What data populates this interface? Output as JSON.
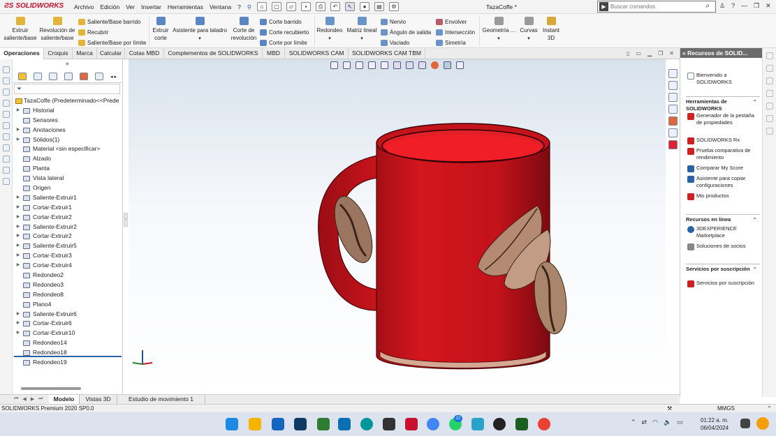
{
  "app": {
    "brand": "SOLIDWORKS",
    "doc_title": "TazaCoffe *",
    "menus": [
      "Archivo",
      "Edición",
      "Ver",
      "Insertar",
      "Herramientas",
      "Ventana",
      "?"
    ],
    "search_placeholder": "Buscar comandos"
  },
  "commands": {
    "extrude_boss": "Extruir saliente/base",
    "revolve_boss": "Revolución de saliente/base",
    "swept_boss": "Saliente/Base barrido",
    "loft_boss": "Recubrir",
    "boundary_boss": "Saliente/Base por límite",
    "extrude_cut": "Extruir corte",
    "hole_wizard": "Asistente para taladro",
    "revolve_cut": "Corte de revolución",
    "swept_cut": "Corte barrido",
    "loft_cut": "Corte recubierto",
    "boundary_cut": "Corte por límite",
    "fillet": "Redondeo",
    "linear_pattern": "Matriz lineal",
    "rib": "Nervio",
    "draft": "Ángulo de salida",
    "shell": "Vaciado",
    "wrap": "Envolver",
    "intersect": "Intersección",
    "mirror": "Simetría",
    "ref_geometry": "Geometría ...",
    "curves": "Curvas",
    "instant3d": "Instant 3D"
  },
  "tabs": [
    {
      "label": "Operaciones",
      "active": true
    },
    {
      "label": "Croquis",
      "active": false
    },
    {
      "label": "Marca",
      "active": false
    },
    {
      "label": "Calcular",
      "active": false
    },
    {
      "label": "Cotas MBD",
      "active": false
    },
    {
      "label": "Complementos de SOLIDWORKS",
      "active": false
    },
    {
      "label": "MBD",
      "active": false
    },
    {
      "label": "SOLIDWORKS CAM",
      "active": false
    },
    {
      "label": "SOLIDWORKS CAM TBM",
      "active": false
    }
  ],
  "tree": {
    "root": "TazaCoffe  (Predeterminado<<Prede",
    "items": [
      {
        "label": "Historial",
        "expandable": true
      },
      {
        "label": "Sensores",
        "expandable": false
      },
      {
        "label": "Anotaciones",
        "expandable": true
      },
      {
        "label": "Sólidos(1)",
        "expandable": true
      },
      {
        "label": "Material <sin especificar>",
        "expandable": false
      },
      {
        "label": "Alzado",
        "expandable": false
      },
      {
        "label": "Planta",
        "expandable": false
      },
      {
        "label": "Vista lateral",
        "expandable": false
      },
      {
        "label": "Origen",
        "expandable": false
      },
      {
        "label": "Saliente-Extruir1",
        "expandable": true
      },
      {
        "label": "Cortar-Extruir1",
        "expandable": true
      },
      {
        "label": "Cortar-Extruir2",
        "expandable": true
      },
      {
        "label": "Saliente-Extruir2",
        "expandable": true
      },
      {
        "label": "Cortar-Extruir2",
        "expandable": true
      },
      {
        "label": "Saliente-Extruir5",
        "expandable": true
      },
      {
        "label": "Cortar-Extruir3",
        "expandable": true
      },
      {
        "label": "Cortar-Extruir4",
        "expandable": true
      },
      {
        "label": "Redondeo2",
        "expandable": false
      },
      {
        "label": "Redondeo3",
        "expandable": false
      },
      {
        "label": "Redondeo8",
        "expandable": false
      },
      {
        "label": "Plano4",
        "expandable": false
      },
      {
        "label": "Saliente-Extruir6",
        "expandable": true
      },
      {
        "label": "Cortar-Extruir6",
        "expandable": true
      },
      {
        "label": "Cortar-Extruir10",
        "expandable": true
      },
      {
        "label": "Redondeo14",
        "expandable": false
      },
      {
        "label": "Redondeo18",
        "expandable": false
      },
      {
        "label": "Redondeo19",
        "expandable": false
      }
    ]
  },
  "task_pane": {
    "title": "Recursos de SOLID...",
    "welcome": "Bienvenido a SOLIDWORKS",
    "tools_section": "Herramientas de SOLIDWORKS",
    "tools": [
      "Generador de la pestaña de propiedades",
      "SOLIDWORKS Rx",
      "Prueba comparativa de rendimiento",
      "Comparar My Score",
      "Asistente para copiar configuraciones",
      "Mis productos"
    ],
    "online_section": "Recursos en línea",
    "online": [
      "3DEXPERIENCE Marketplace",
      "Soluciones de socios"
    ],
    "subscription_section": "Servicios por suscripción",
    "subscription": [
      "Servicios por suscripción"
    ]
  },
  "bottom_tabs": [
    {
      "label": "Modelo",
      "active": true
    },
    {
      "label": "Vistas 3D",
      "active": false
    },
    {
      "label": "Estudio de movimiento 1",
      "active": false
    }
  ],
  "status": {
    "product": "SOLIDWORKS Premium 2020 SP0.0",
    "units": "MMGS"
  },
  "taskbar": {
    "time": "01:22 a. m.",
    "date": "06/04/2024",
    "notifications": "12"
  },
  "colors": {
    "mug_red": "#c8141c",
    "bean_brown": "#a9856b",
    "accent_blue": "#2a62a8"
  }
}
